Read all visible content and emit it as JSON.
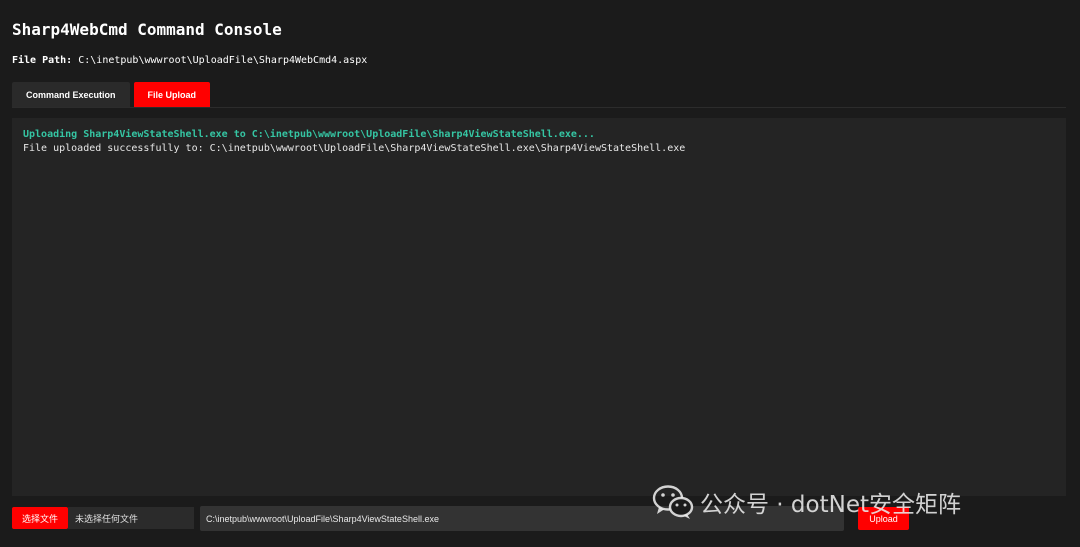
{
  "app": {
    "title": "Sharp4WebCmd Command Console"
  },
  "file_path": {
    "label": "File Path:",
    "value": "C:\\inetpub\\wwwroot\\UploadFile\\Sharp4WebCmd4.aspx"
  },
  "tabs": [
    {
      "label": "Command Execution",
      "active": false
    },
    {
      "label": "File Upload",
      "active": true
    }
  ],
  "console": {
    "lines": [
      {
        "type": "info",
        "text": "Uploading Sharp4ViewStateShell.exe to C:\\inetpub\\wwwroot\\UploadFile\\Sharp4ViewStateShell.exe..."
      },
      {
        "type": "ok",
        "text": "File uploaded successfully to: C:\\inetpub\\wwwroot\\UploadFile\\Sharp4ViewStateShell.exe\\Sharp4ViewStateShell.exe"
      }
    ]
  },
  "upload_form": {
    "choose_file_label": "选择文件",
    "no_file_text": "未选择任何文件",
    "path_value": "C:\\inetpub\\wwwroot\\UploadFile\\Sharp4ViewStateShell.exe",
    "upload_label": "Upload"
  },
  "watermark": {
    "icon": "wechat-icon",
    "text": "公众号 · dotNet安全矩阵"
  },
  "colors": {
    "accent": "#ff0000",
    "console_info": "#35c5a3",
    "background": "#1b1b1b",
    "console_bg": "#242424"
  }
}
